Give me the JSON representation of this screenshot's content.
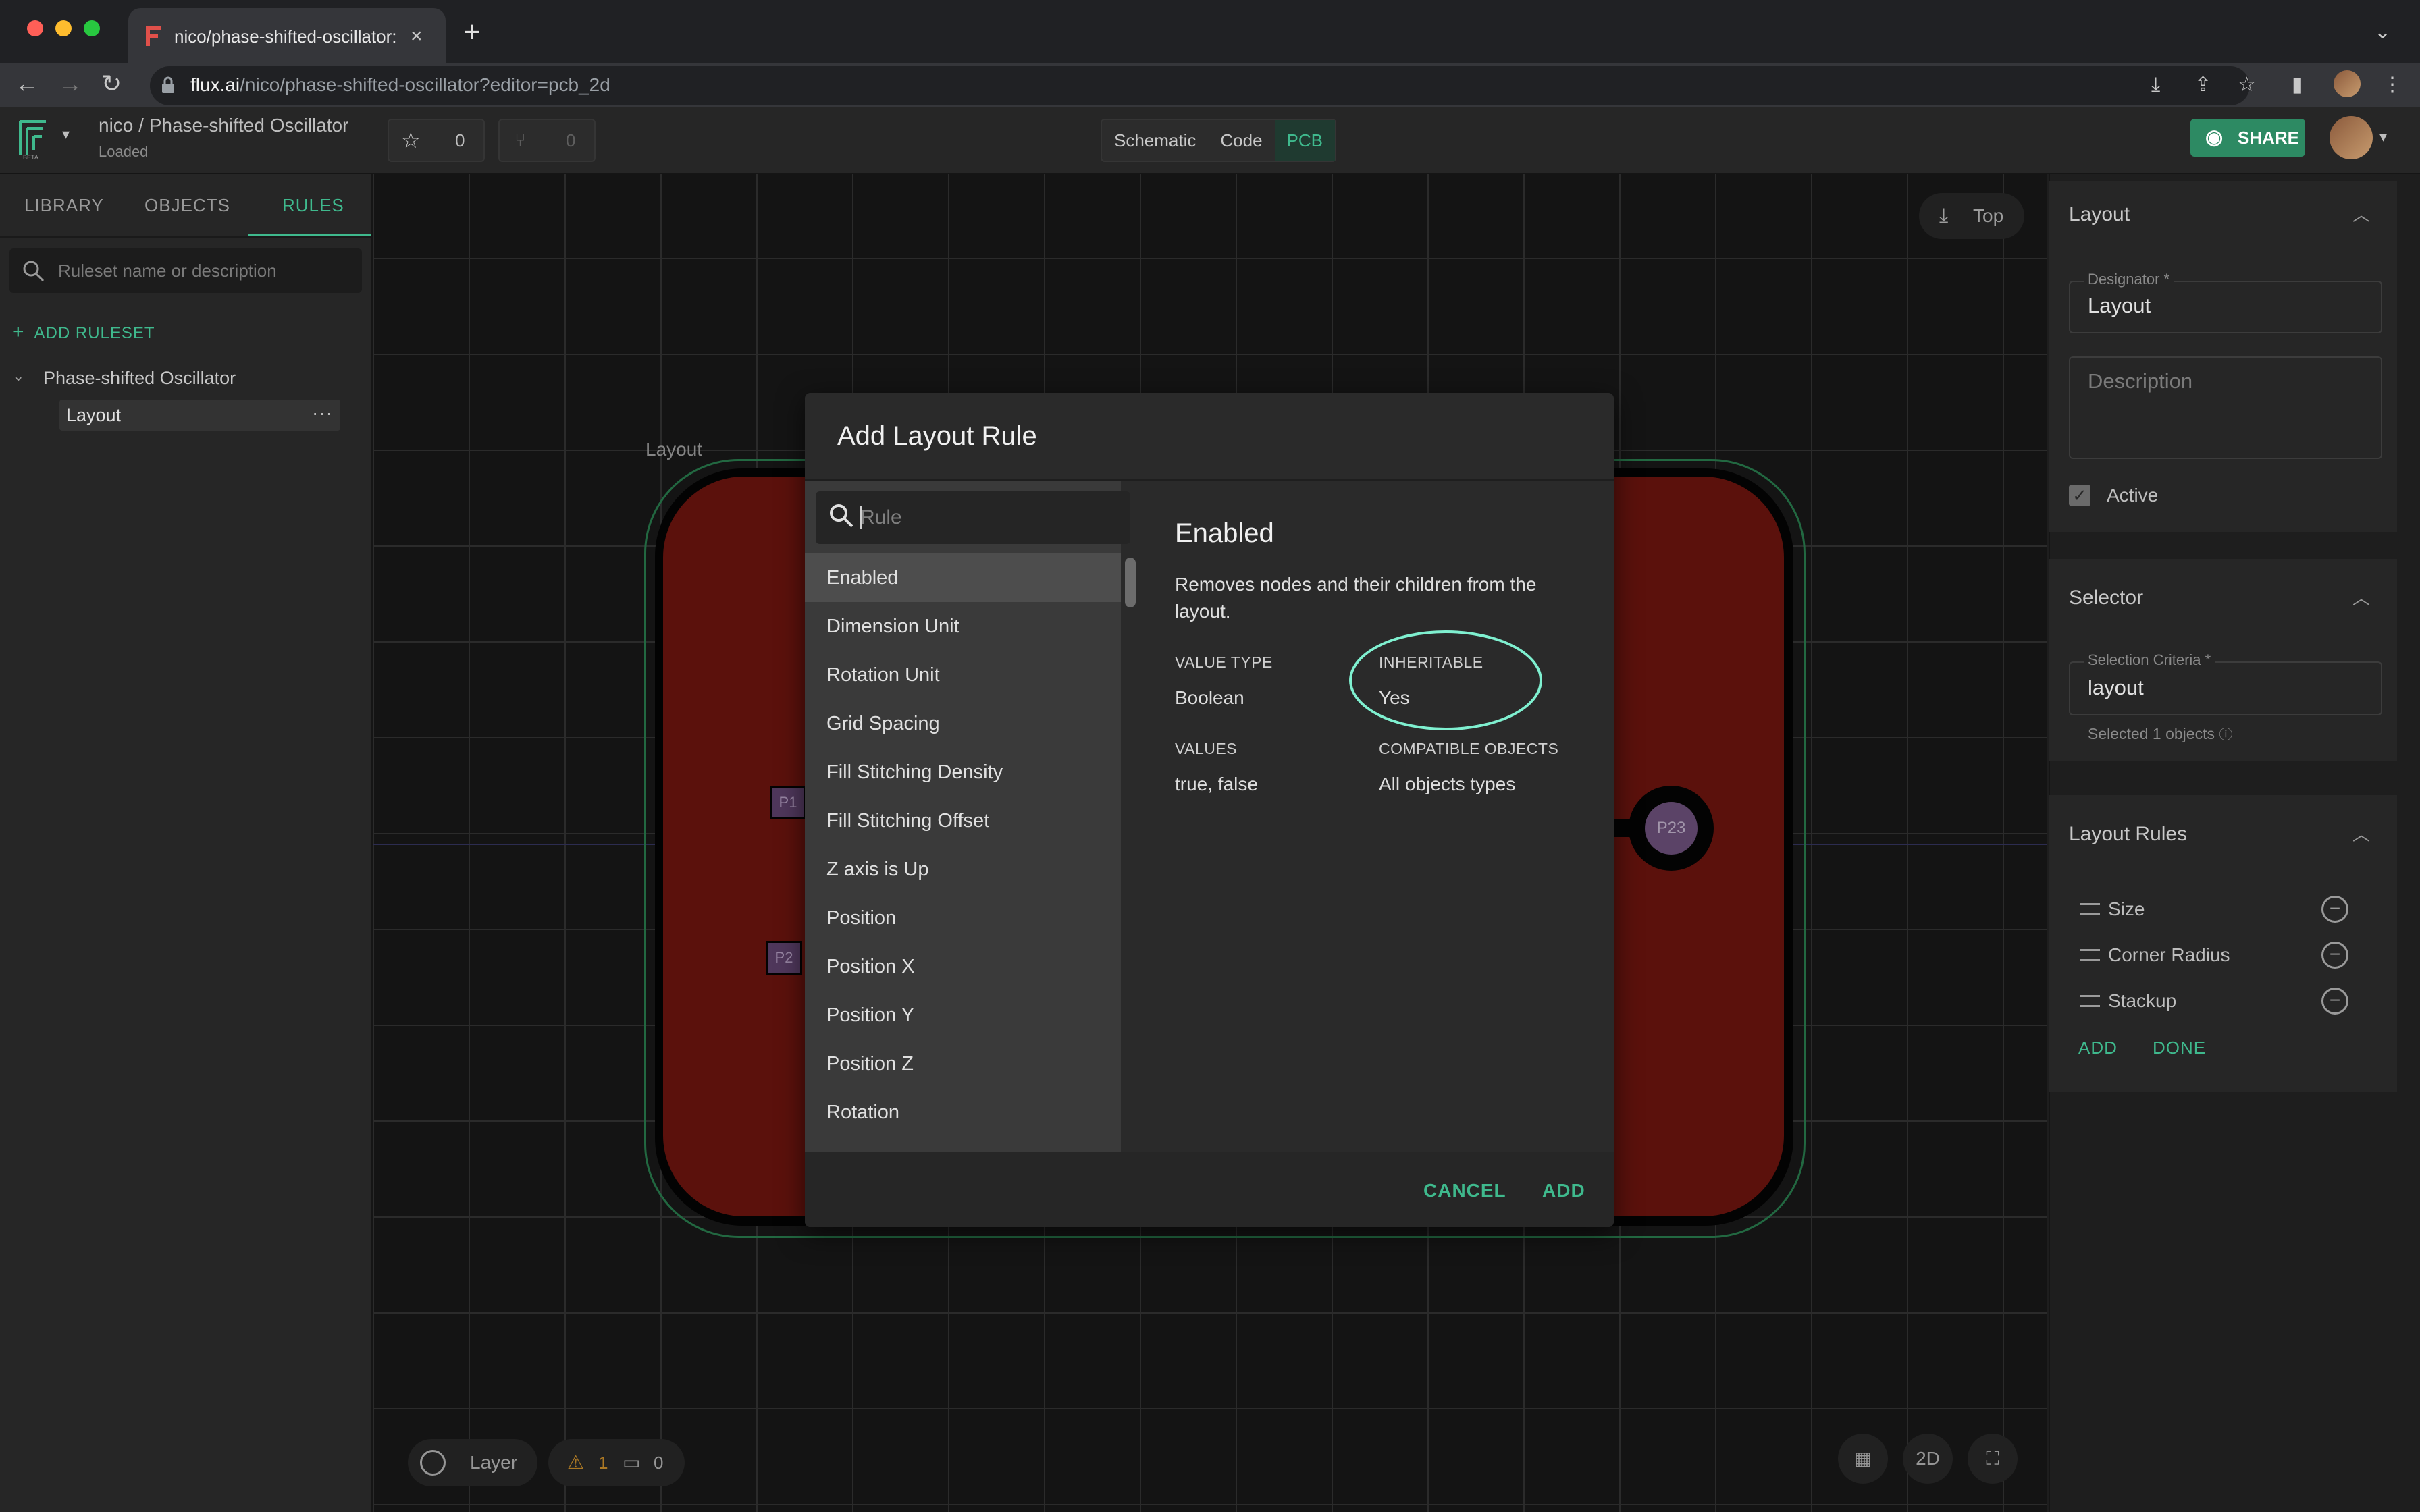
{
  "browser": {
    "tab_title": "nico/phase-shifted-oscillator: F",
    "tab_close": "×",
    "new_tab": "+",
    "url_host": "flux.ai",
    "url_path": "/nico/phase-shifted-oscillator?editor=pcb_2d"
  },
  "header": {
    "project_path": "nico / Phase-shifted Oscillator",
    "status": "Loaded",
    "star_count": "0",
    "fork_count": "0",
    "modes": [
      "Schematic",
      "Code",
      "PCB"
    ],
    "active_mode": "PCB",
    "share_label": "SHARE"
  },
  "sidebar": {
    "tabs": [
      "LIBRARY",
      "OBJECTS",
      "RULES"
    ],
    "active_tab": "RULES",
    "search_placeholder": "Ruleset name or description",
    "add_ruleset": "ADD RULESET",
    "tree_project": "Phase-shifted Oscillator",
    "tree_item": "Layout",
    "tree_more": "···"
  },
  "canvas": {
    "board_label": "Layout",
    "view_button": "Top",
    "pads": [
      "P1",
      "P2",
      "P23"
    ],
    "layer_label": "Layer",
    "warnings": "1",
    "comments": "0",
    "mode_2d": "2D"
  },
  "right_panel": {
    "layout_title": "Layout",
    "designator_label": "Designator *",
    "designator_value": "Layout",
    "description_placeholder": "Description",
    "active_label": "Active",
    "active_checked": true,
    "selector_title": "Selector",
    "criteria_label": "Selection Criteria *",
    "criteria_value": "layout",
    "selected_count": "Selected 1 objects",
    "rules_title": "Layout Rules",
    "rules": [
      "Size",
      "Corner Radius",
      "Stackup"
    ],
    "add_label": "ADD",
    "done_label": "DONE"
  },
  "modal": {
    "title": "Add Layout Rule",
    "search_placeholder": "Rule",
    "rules": [
      "Enabled",
      "Dimension Unit",
      "Rotation Unit",
      "Grid Spacing",
      "Fill Stitching Density",
      "Fill Stitching Offset",
      "Z axis is Up",
      "Position",
      "Position X",
      "Position Y",
      "Position Z",
      "Rotation"
    ],
    "selected_rule": "Enabled",
    "detail": {
      "name": "Enabled",
      "description": "Removes nodes and their children from the layout.",
      "value_type_label": "VALUE TYPE",
      "value_type": "Boolean",
      "inheritable_label": "INHERITABLE",
      "inheritable": "Yes",
      "values_label": "VALUES",
      "values": "true, false",
      "compatible_label": "COMPATIBLE OBJECTS",
      "compatible": "All objects types"
    },
    "cancel_label": "CANCEL",
    "add_label": "ADD"
  },
  "colors": {
    "accent": "#3fb98d",
    "board_red": "#7a1710",
    "highlight_circle": "#7ff0d0",
    "warning": "#e5a030"
  }
}
